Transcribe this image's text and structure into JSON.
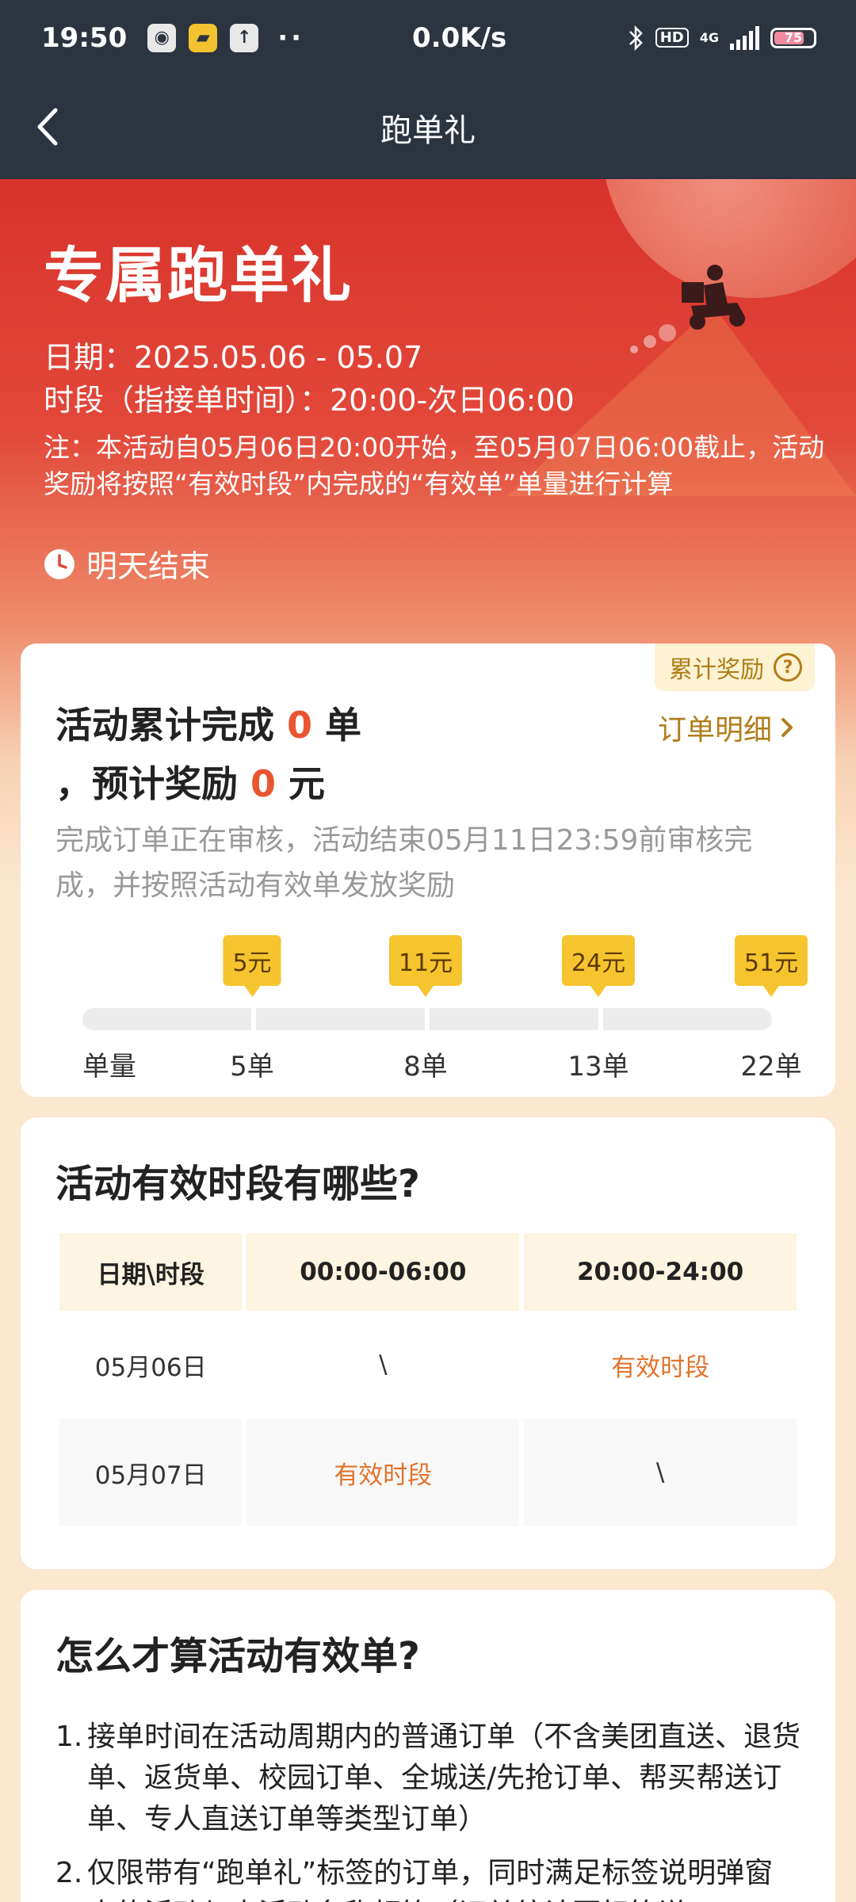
{
  "status_bar": {
    "time": "19:50",
    "network_speed": "0.0K/s",
    "hd_label": "HD",
    "signal_label": "4G",
    "battery": "75",
    "icons": [
      "app-notify-icon",
      "folder-icon",
      "upload-icon"
    ]
  },
  "nav": {
    "title": "跑单礼"
  },
  "hero": {
    "title": "专属跑单礼",
    "date_line": "日期：2025.05.06 - 05.07",
    "period_line": "时段（指接单时间）：20:00-次日06:00",
    "note": "注：本活动自05月06日20:00开始，至05月07日06:00截止，活动奖励将按照“有效时段”内完成的“有效单”单量进行计算",
    "countdown": "明天结束"
  },
  "reward": {
    "tag_label": "累计奖励",
    "line1_prefix": "活动累计完成 ",
    "completed_count": "0",
    "line1_suffix": " 单",
    "line2_prefix": "，预计奖励 ",
    "reward_amount": "0",
    "line2_suffix": " 元",
    "detail_link": "订单明细",
    "subtext": "完成订单正在审核，活动结束05月11日23:59前审核完成，并按照活动有效单发放奖励",
    "axis_label": "单量",
    "milestones": [
      {
        "orders": "5单",
        "reward": "5元"
      },
      {
        "orders": "8单",
        "reward": "11元"
      },
      {
        "orders": "13单",
        "reward": "24元"
      },
      {
        "orders": "22单",
        "reward": "51元"
      }
    ],
    "progress_fraction": 0
  },
  "periods": {
    "title": "活动有效时段有哪些?",
    "headers": [
      "日期\\时段",
      "00:00-06:00",
      "20:00-24:00"
    ],
    "rows": [
      [
        "05月06日",
        "\\",
        "有效时段"
      ],
      [
        "05月07日",
        "有效时段",
        "\\"
      ]
    ]
  },
  "rules": {
    "title": "怎么才算活动有效单?",
    "items": [
      {
        "idx": "1.",
        "text": "接单时间在活动周期内的普通订单（不含美团直送、退货单、返货单、校园订单、全城送/先抢订单、帮买帮送订单、专人直送订单等类型订单）"
      },
      {
        "idx": "2.",
        "text": "仅限带有“跑单礼”标签的订单，同时满足标签说明弹窗中的活动与本活动名称相符（订单统计页标签说"
      }
    ]
  },
  "colors": {
    "accent_orange": "#e8552f",
    "gold_text": "#b07d18",
    "badge_yellow": "#f6c42e",
    "header_dark": "#2c3440",
    "hero_red": "#d8332b"
  }
}
